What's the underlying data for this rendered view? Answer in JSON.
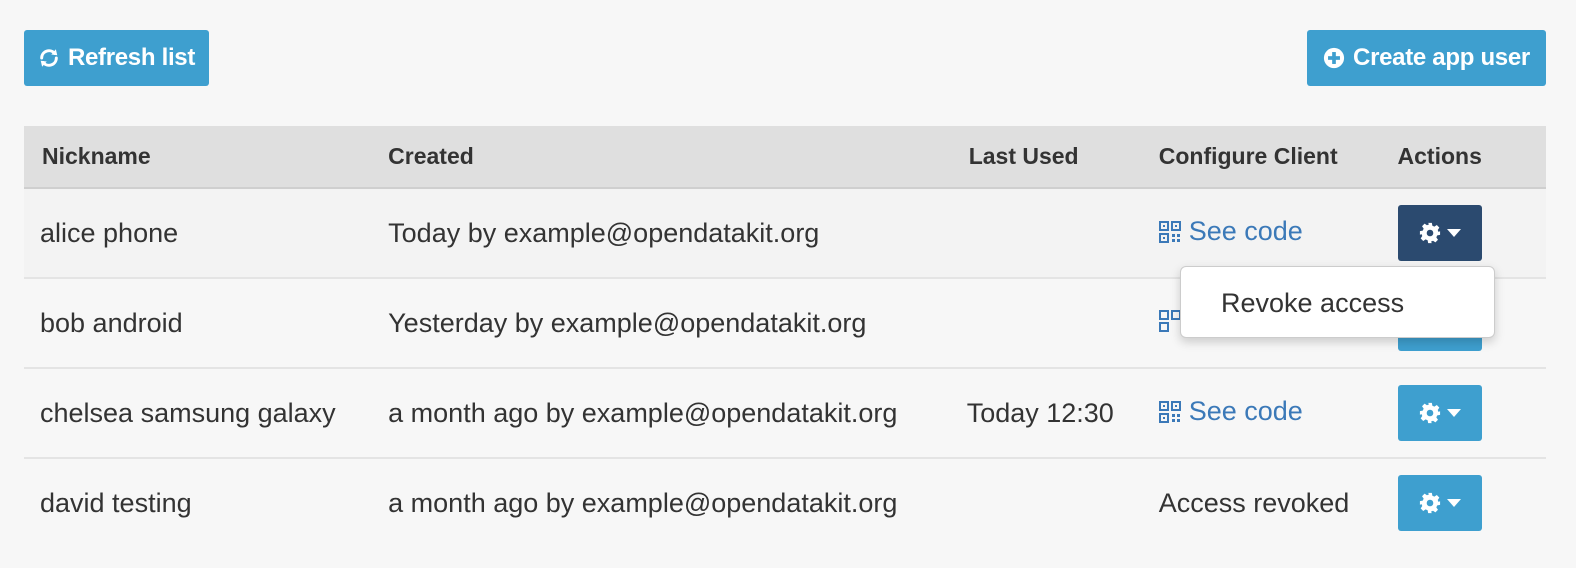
{
  "toolbar": {
    "refresh_label": "Refresh list",
    "create_label": "Create app user"
  },
  "table": {
    "headers": {
      "nickname": "Nickname",
      "created": "Created",
      "last_used": "Last Used",
      "configure_client": "Configure Client",
      "actions": "Actions"
    },
    "rows": [
      {
        "nickname": "alice phone",
        "created": "Today by example@opendatakit.org",
        "last_used": "",
        "configure": "See code"
      },
      {
        "nickname": "bob android",
        "created": "Yesterday by example@opendatakit.org",
        "last_used": "",
        "configure": ""
      },
      {
        "nickname": "chelsea samsung galaxy",
        "created": "a month ago by example@opendatakit.org",
        "last_used": "Today 12:30",
        "configure": "See code"
      },
      {
        "nickname": "david testing",
        "created": "a month ago by example@opendatakit.org",
        "last_used": "",
        "configure": "Access revoked"
      }
    ]
  },
  "dropdown": {
    "revoke_label": "Revoke access"
  },
  "icons": {
    "refresh": "refresh-icon",
    "create": "plus-circle-icon",
    "qr": "qrcode-icon",
    "gear": "gear-icon",
    "caret": "caret-down-icon"
  },
  "colors": {
    "primary": "#3e9fcf",
    "primary_active": "#2b4a6f",
    "link": "#3b79b8",
    "header_bg": "#dfdfdf",
    "page_bg": "#f7f7f7"
  }
}
